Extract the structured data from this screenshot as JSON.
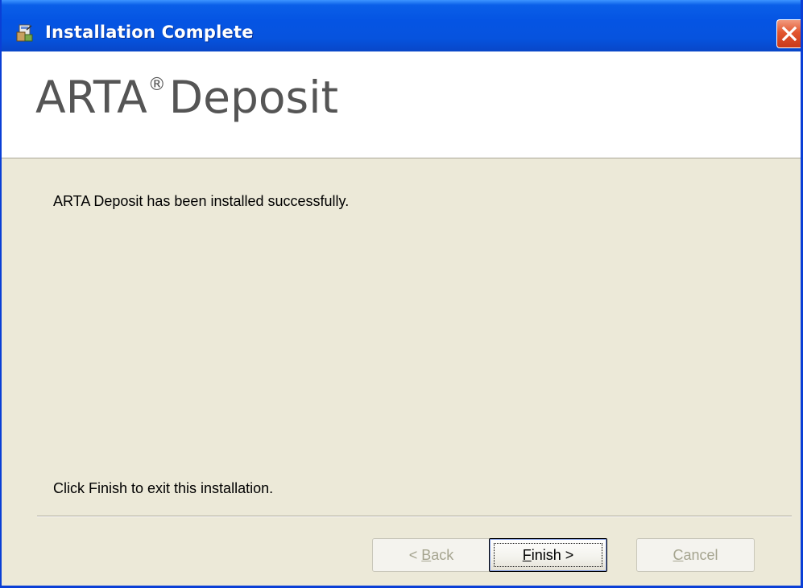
{
  "window": {
    "title": "Installation Complete"
  },
  "banner": {
    "product_name": "ARTA",
    "registered_mark": "®",
    "product_suffix": "Deposit"
  },
  "body": {
    "success_message": "ARTA Deposit has been installed successfully.",
    "exit_message": "Click Finish to exit this installation."
  },
  "buttons": {
    "back": {
      "mnemonic": "B",
      "rest": "ack",
      "prefix": "< ",
      "enabled": false
    },
    "finish": {
      "mnemonic": "F",
      "rest": "inish >",
      "enabled": true,
      "focused": true
    },
    "cancel": {
      "mnemonic": "C",
      "rest": "ancel",
      "enabled": false
    }
  },
  "colors": {
    "titlebar": "#0554e3",
    "close_button": "#e2562f",
    "dialog_background": "#ece9d8",
    "banner_text": "#555555"
  }
}
